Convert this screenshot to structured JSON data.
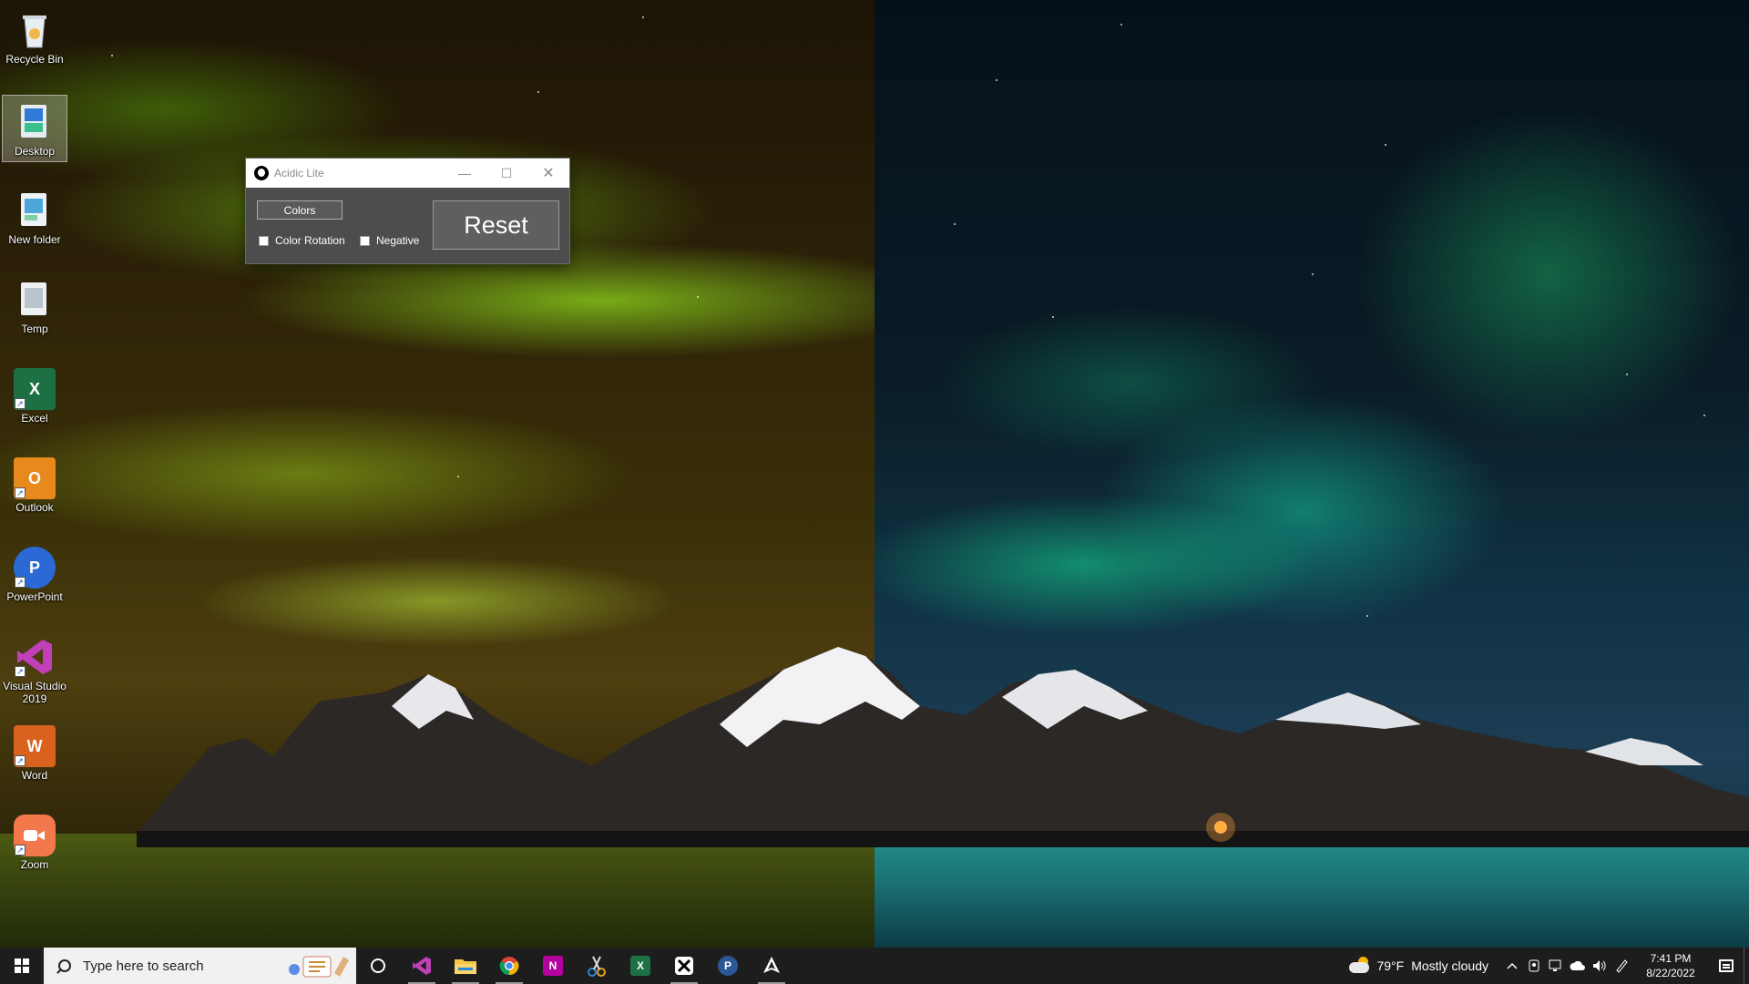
{
  "desktop": {
    "icons": [
      {
        "label": "Recycle Bin",
        "icon": "recycle-bin-icon"
      },
      {
        "label": "Desktop",
        "icon": "desktop-folder-icon"
      },
      {
        "label": "New folder",
        "icon": "folder-icon"
      },
      {
        "label": "Temp",
        "icon": "folder-icon"
      },
      {
        "label": "Excel",
        "icon": "excel-icon"
      },
      {
        "label": "Outlook",
        "icon": "outlook-icon"
      },
      {
        "label": "PowerPoint",
        "icon": "powerpoint-icon"
      },
      {
        "label": "Visual Studio 2019",
        "icon": "visual-studio-icon"
      },
      {
        "label": "Word",
        "icon": "word-icon"
      },
      {
        "label": "Zoom",
        "icon": "zoom-icon"
      }
    ],
    "selected_icon": "Desktop"
  },
  "window": {
    "title": "Acidic Lite",
    "colors_button": "Colors",
    "color_rotation_label": "Color Rotation",
    "color_rotation_checked": false,
    "negative_label": "Negative",
    "negative_checked": false,
    "reset_button": "Reset",
    "min_glyph": "—",
    "max_glyph": "☐",
    "close_glyph": "✕"
  },
  "taskbar": {
    "search_placeholder": "Type here to search",
    "pinned": [
      {
        "name": "visual-studio",
        "letter": "",
        "color": "#b74fd6"
      },
      {
        "name": "file-explorer",
        "letter": "",
        "color": "#f4c542"
      },
      {
        "name": "chrome",
        "letter": "",
        "color": "#db4437"
      },
      {
        "name": "onenote",
        "letter": "N",
        "color": "#b4009e"
      },
      {
        "name": "snipping-tool",
        "letter": "",
        "color": "#2b88d8"
      },
      {
        "name": "excel",
        "letter": "X",
        "color": "#1d7044"
      },
      {
        "name": "acidic-lite",
        "letter": "",
        "color": "#ffffff"
      },
      {
        "name": "powerpoint",
        "letter": "P",
        "color": "#2b5797"
      },
      {
        "name": "inkscape-app",
        "letter": "",
        "color": "#ffffff"
      }
    ],
    "weather": {
      "temp": "79°F",
      "condition": "Mostly cloudy"
    },
    "clock": {
      "time": "7:41 PM",
      "date": "8/22/2022"
    }
  },
  "colors": {
    "taskbar": "#1d1d1d",
    "window_body": "#4d4d4d"
  }
}
